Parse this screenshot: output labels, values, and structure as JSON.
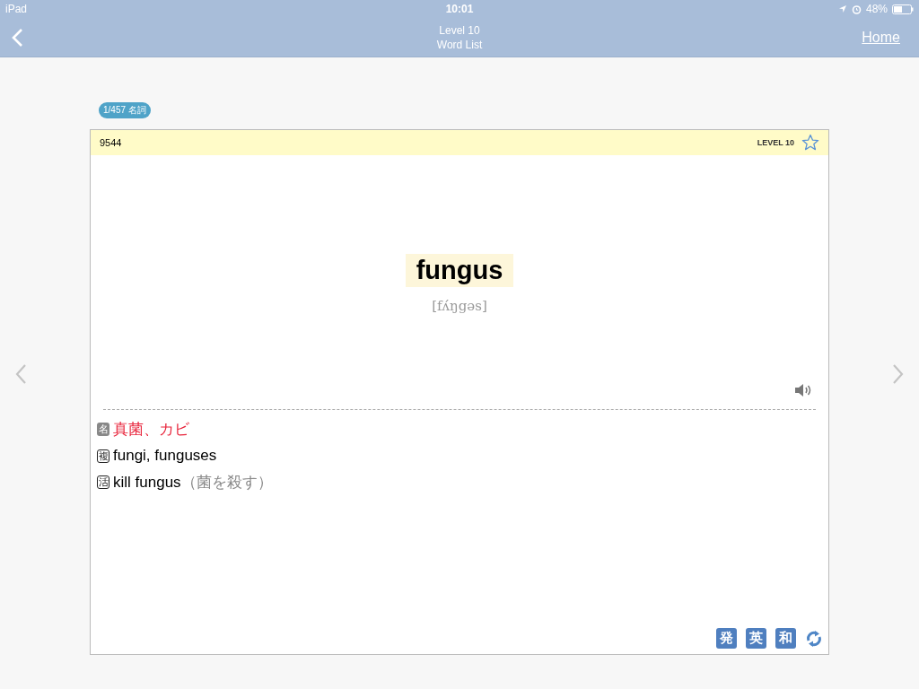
{
  "status_bar": {
    "device": "iPad",
    "time": "10:01",
    "battery": "48%"
  },
  "nav": {
    "title": "Level 10",
    "subtitle": "Word List",
    "home": "Home"
  },
  "counter": "1/457 名詞",
  "card": {
    "number": "9544",
    "level": "LEVEL 10",
    "starred": false,
    "word": "fungus",
    "pronunciation": "[fʌ́ŋgəs]",
    "lines": [
      {
        "kind": "meaning",
        "tag": "名",
        "text": "真菌、カビ"
      },
      {
        "kind": "plural",
        "tag": "複",
        "text": "fungi, funguses"
      },
      {
        "kind": "usage",
        "tag": "活",
        "text": "kill fungus",
        "gloss": "（菌を殺す）"
      }
    ],
    "buttons": [
      "発",
      "英",
      "和"
    ]
  }
}
